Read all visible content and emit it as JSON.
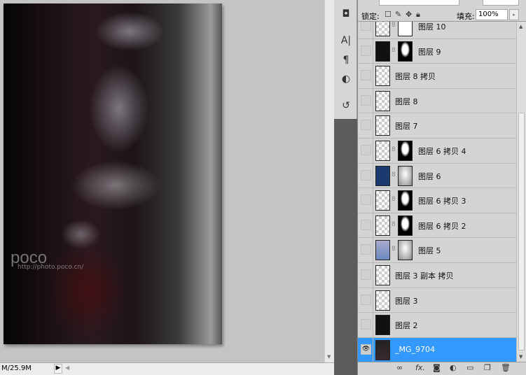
{
  "canvas": {
    "watermark": "poco",
    "watermark_url": "http://photo.poco.cn/"
  },
  "status": {
    "doc_size": "M/25.9M"
  },
  "layers_panel": {
    "lock_label": "锁定:",
    "fill_label": "填充:",
    "fill_value": "100%",
    "layers": [
      {
        "name": "图层 10",
        "visible": false,
        "thumb": "checker",
        "mask": "white"
      },
      {
        "name": "图层 9",
        "visible": false,
        "thumb": "dark",
        "mask": "black"
      },
      {
        "name": "图层 8 拷贝",
        "visible": false,
        "thumb": "checker"
      },
      {
        "name": "图层 8",
        "visible": false,
        "thumb": "checker"
      },
      {
        "name": "图层 7",
        "visible": false,
        "thumb": "checker"
      },
      {
        "name": "图层 6 拷贝 4",
        "visible": false,
        "thumb": "checker",
        "mask": "black"
      },
      {
        "name": "图层 6",
        "visible": false,
        "thumb": "blue",
        "mask": "grey"
      },
      {
        "name": "图层 6 拷贝 3",
        "visible": false,
        "thumb": "checker",
        "mask": "black"
      },
      {
        "name": "图层 6 拷贝 2",
        "visible": false,
        "thumb": "checker",
        "mask": "black"
      },
      {
        "name": "图层 5",
        "visible": false,
        "thumb": "bluish",
        "mask": "grey"
      },
      {
        "name": "图层 3 副本 拷贝",
        "visible": false,
        "thumb": "checker"
      },
      {
        "name": "图层 3",
        "visible": false,
        "thumb": "checker"
      },
      {
        "name": "图层 2",
        "visible": false,
        "thumb": "dark"
      },
      {
        "name": "_MG_9704",
        "visible": true,
        "selected": true,
        "thumb": "photo"
      }
    ],
    "selected_color": "#3399ff"
  }
}
